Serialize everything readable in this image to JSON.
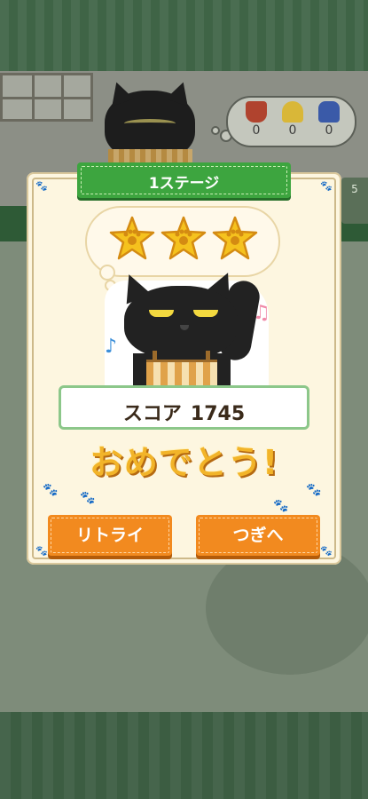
{
  "stage": {
    "title": "1ステージ"
  },
  "result": {
    "stars_earned": 3,
    "stars_total": 3,
    "score_label": "スコア",
    "score_value": "1745",
    "message": "おめでとう!"
  },
  "buttons": {
    "retry_label": "リトライ",
    "next_label": "つぎへ"
  },
  "inventory": {
    "items": [
      {
        "icon": "red-pot-icon",
        "count": "0",
        "color": "#b0432e"
      },
      {
        "icon": "yellow-bell-icon",
        "count": "0",
        "color": "#d9b738"
      },
      {
        "icon": "blue-bottle-icon",
        "count": "0",
        "color": "#3a5aa8"
      }
    ]
  },
  "background": {
    "side_counter": "5"
  },
  "colors": {
    "ribbon": "#3da53f",
    "button": "#f28a1f",
    "star": "#f5c21e",
    "message": "#f2b429",
    "panel": "#fdf6e0"
  }
}
